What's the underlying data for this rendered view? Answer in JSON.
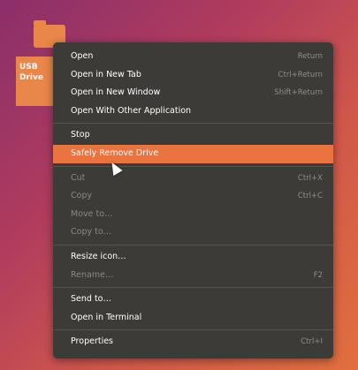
{
  "desktop_icon": {
    "label": "USB Drive"
  },
  "context_menu": {
    "items": [
      {
        "label": "Open",
        "accel": "Return",
        "disabled": false
      },
      {
        "label": "Open in New Tab",
        "accel": "Ctrl+Return",
        "disabled": false
      },
      {
        "label": "Open in New Window",
        "accel": "Shift+Return",
        "disabled": false
      },
      {
        "label": "Open With Other Application",
        "accel": "",
        "disabled": false
      },
      {
        "label": "Stop",
        "accel": "",
        "disabled": false
      },
      {
        "label": "Safely Remove Drive",
        "accel": "",
        "disabled": false,
        "active": true
      },
      {
        "label": "Cut",
        "accel": "Ctrl+X",
        "disabled": true
      },
      {
        "label": "Copy",
        "accel": "Ctrl+C",
        "disabled": true
      },
      {
        "label": "Move to…",
        "accel": "",
        "disabled": true
      },
      {
        "label": "Copy to…",
        "accel": "",
        "disabled": true
      },
      {
        "label": "Resize icon…",
        "accel": "",
        "disabled": false
      },
      {
        "label": "Rename…",
        "accel": "F2",
        "disabled": true
      },
      {
        "label": "Send to…",
        "accel": "",
        "disabled": false
      },
      {
        "label": "Open in Terminal",
        "accel": "",
        "disabled": false
      },
      {
        "label": "Properties",
        "accel": "Ctrl+I",
        "disabled": false
      }
    ]
  }
}
